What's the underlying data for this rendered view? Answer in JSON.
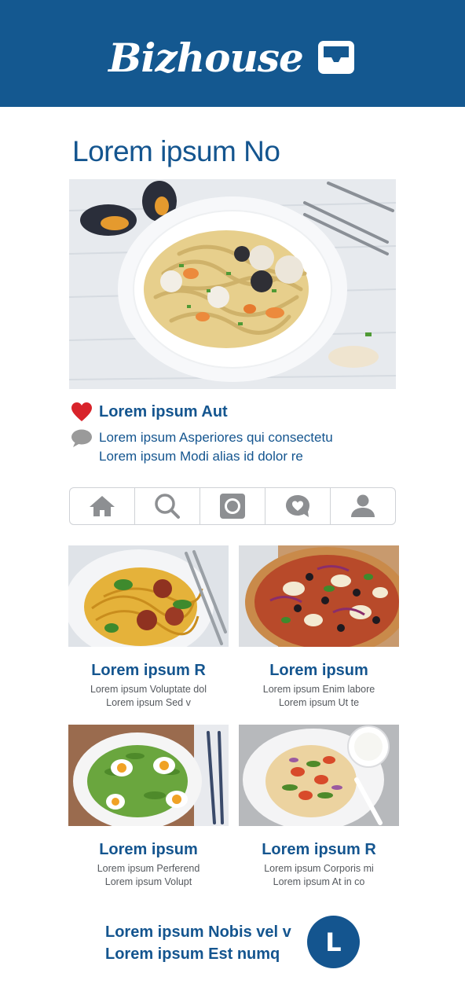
{
  "app": {
    "brand": "Bizhouse"
  },
  "post": {
    "title": "Lorem ipsum No",
    "author": "Lorem ipsum Aut",
    "comment_line1": "Lorem ipsum Asperiores qui consectetu",
    "comment_line2": "Lorem ipsum Modi alias id dolor re"
  },
  "tabs": [
    {
      "icon": "home-icon"
    },
    {
      "icon": "search-icon"
    },
    {
      "icon": "camera-icon"
    },
    {
      "icon": "heart-bubble-icon"
    },
    {
      "icon": "user-icon"
    }
  ],
  "cards": [
    {
      "title": "Lorem ipsum R",
      "line1": "Lorem ipsum Voluptate dol",
      "line2": "Lorem ipsum Sed v"
    },
    {
      "title": "Lorem ipsum",
      "line1": "Lorem ipsum Enim labore",
      "line2": "Lorem ipsum Ut te"
    },
    {
      "title": "Lorem ipsum",
      "line1": "Lorem ipsum Perferend",
      "line2": "Lorem ipsum Volupt"
    },
    {
      "title": "Lorem ipsum R",
      "line1": "Lorem ipsum Corporis mi",
      "line2": "Lorem ipsum At in co"
    }
  ],
  "footer": {
    "line1": "Lorem ipsum Nobis vel v",
    "line2": "Lorem ipsum Est numq",
    "avatar_initial": "L"
  },
  "colors": {
    "primary": "#14558f",
    "header_bg": "#145890",
    "like": "#d8232a",
    "muted": "#9a9a9a"
  }
}
